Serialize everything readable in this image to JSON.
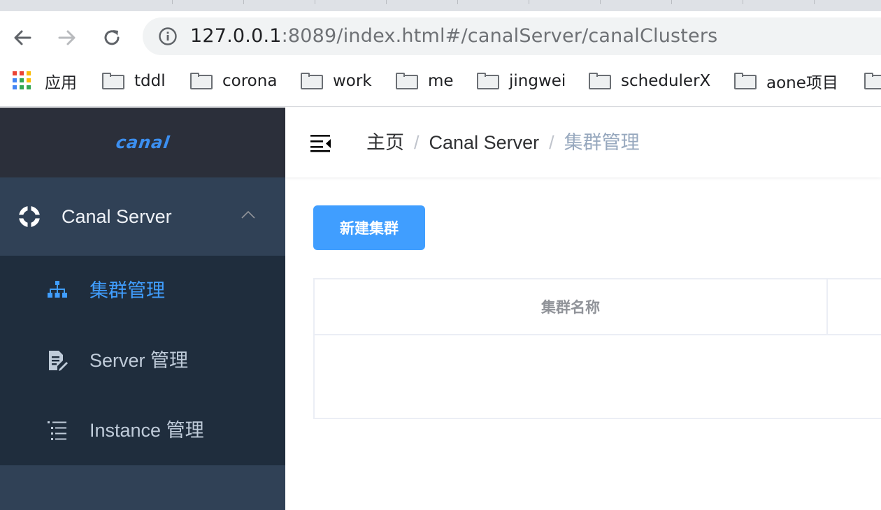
{
  "browser": {
    "url_host": "127.0.0.1",
    "url_rest": ":8089/index.html#/canalServer/canalClusters",
    "bookmarks": [
      {
        "label": "应用"
      },
      {
        "label": "tddl"
      },
      {
        "label": "corona"
      },
      {
        "label": "work"
      },
      {
        "label": "me"
      },
      {
        "label": "jingwei"
      },
      {
        "label": "schedulerX"
      },
      {
        "label": "aone项目"
      }
    ]
  },
  "sidebar": {
    "logo": "canal",
    "parent": {
      "label": "Canal Server",
      "icon": "lifebuoy-icon",
      "expanded": true
    },
    "items": [
      {
        "label": "集群管理",
        "icon": "sitemap-icon",
        "active": true
      },
      {
        "label": "Server 管理",
        "icon": "document-edit-icon",
        "active": false
      },
      {
        "label": "Instance 管理",
        "icon": "list-icon",
        "active": false
      }
    ]
  },
  "header": {
    "breadcrumb": [
      "主页",
      "Canal Server",
      "集群管理"
    ],
    "separator": "/"
  },
  "main": {
    "new_button": "新建集群",
    "table": {
      "columns": [
        "集群名称"
      ],
      "rows": []
    }
  },
  "colors": {
    "sidebar_bg": "#304156",
    "submenu_bg": "#1f2d3d",
    "logo_bg": "#2b2f3a",
    "active": "#409eff",
    "primary_button": "#409eff"
  }
}
